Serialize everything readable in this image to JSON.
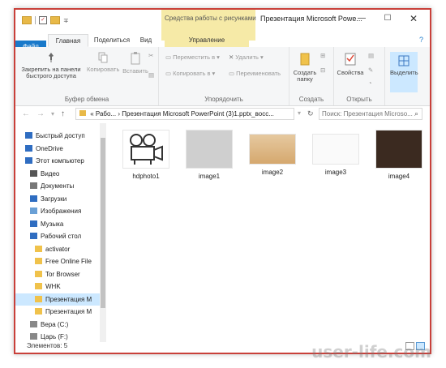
{
  "window": {
    "title": "Презентация Microsoft Powe...",
    "context_tab": "Средства работы с рисунками",
    "qat_arrow": "∓"
  },
  "tabs": {
    "file": "Файл",
    "home": "Главная",
    "share": "Поделиться",
    "view": "Вид",
    "manage": "Управление"
  },
  "ribbon": {
    "pin_label": "Закрепить на панели быстрого доступа",
    "copy_label": "Копировать",
    "paste_label": "Вставить",
    "clipboard_group": "Буфер обмена",
    "move_label": "Переместить в",
    "copy_to_label": "Копировать в",
    "delete_label": "Удалить",
    "rename_label": "Переименовать",
    "organize_group": "Упорядочить",
    "new_folder_label": "Создать папку",
    "new_group": "Создать",
    "properties_label": "Свойства",
    "open_group": "Открыть",
    "select_label": "Выделить"
  },
  "address": {
    "path_prefix": "« Рабо... ›",
    "path_current": "Презентация Microsoft PowerPoint (3)1.pptx_восс...",
    "search_placeholder": "Поиск: Презентация Microso..."
  },
  "nav": {
    "items": [
      {
        "label": "Быстрый доступ",
        "icon": "star-icon"
      },
      {
        "label": "OneDrive",
        "icon": "cloud-icon"
      },
      {
        "label": "Этот компьютер",
        "icon": "computer-icon"
      },
      {
        "label": "Видео",
        "icon": "video-icon"
      },
      {
        "label": "Документы",
        "icon": "documents-icon"
      },
      {
        "label": "Загрузки",
        "icon": "download-icon"
      },
      {
        "label": "Изображения",
        "icon": "pictures-icon"
      },
      {
        "label": "Музыка",
        "icon": "music-icon"
      },
      {
        "label": "Рабочий стол",
        "icon": "desktop-icon"
      },
      {
        "label": "activator",
        "icon": "folder-icon"
      },
      {
        "label": "Free Online File",
        "icon": "folder-icon"
      },
      {
        "label": "Tor Browser",
        "icon": "folder-icon"
      },
      {
        "label": "WHK",
        "icon": "folder-icon"
      },
      {
        "label": "Презентация M",
        "icon": "folder-icon"
      },
      {
        "label": "Презентация M",
        "icon": "folder-icon"
      },
      {
        "label": "Вера (C:)",
        "icon": "drive-icon"
      },
      {
        "label": "Царь (F:)",
        "icon": "drive-icon"
      }
    ]
  },
  "files": [
    {
      "name": "hdphoto1"
    },
    {
      "name": "image1"
    },
    {
      "name": "image2"
    },
    {
      "name": "image3"
    },
    {
      "name": "image4"
    }
  ],
  "status": {
    "count": "Элементов: 5"
  },
  "watermark": "user-life.com",
  "colors": {
    "accent": "#1979ca",
    "context_tab": "#f6eaa7",
    "selection": "#cce8ff",
    "frame": "#c9403a"
  }
}
